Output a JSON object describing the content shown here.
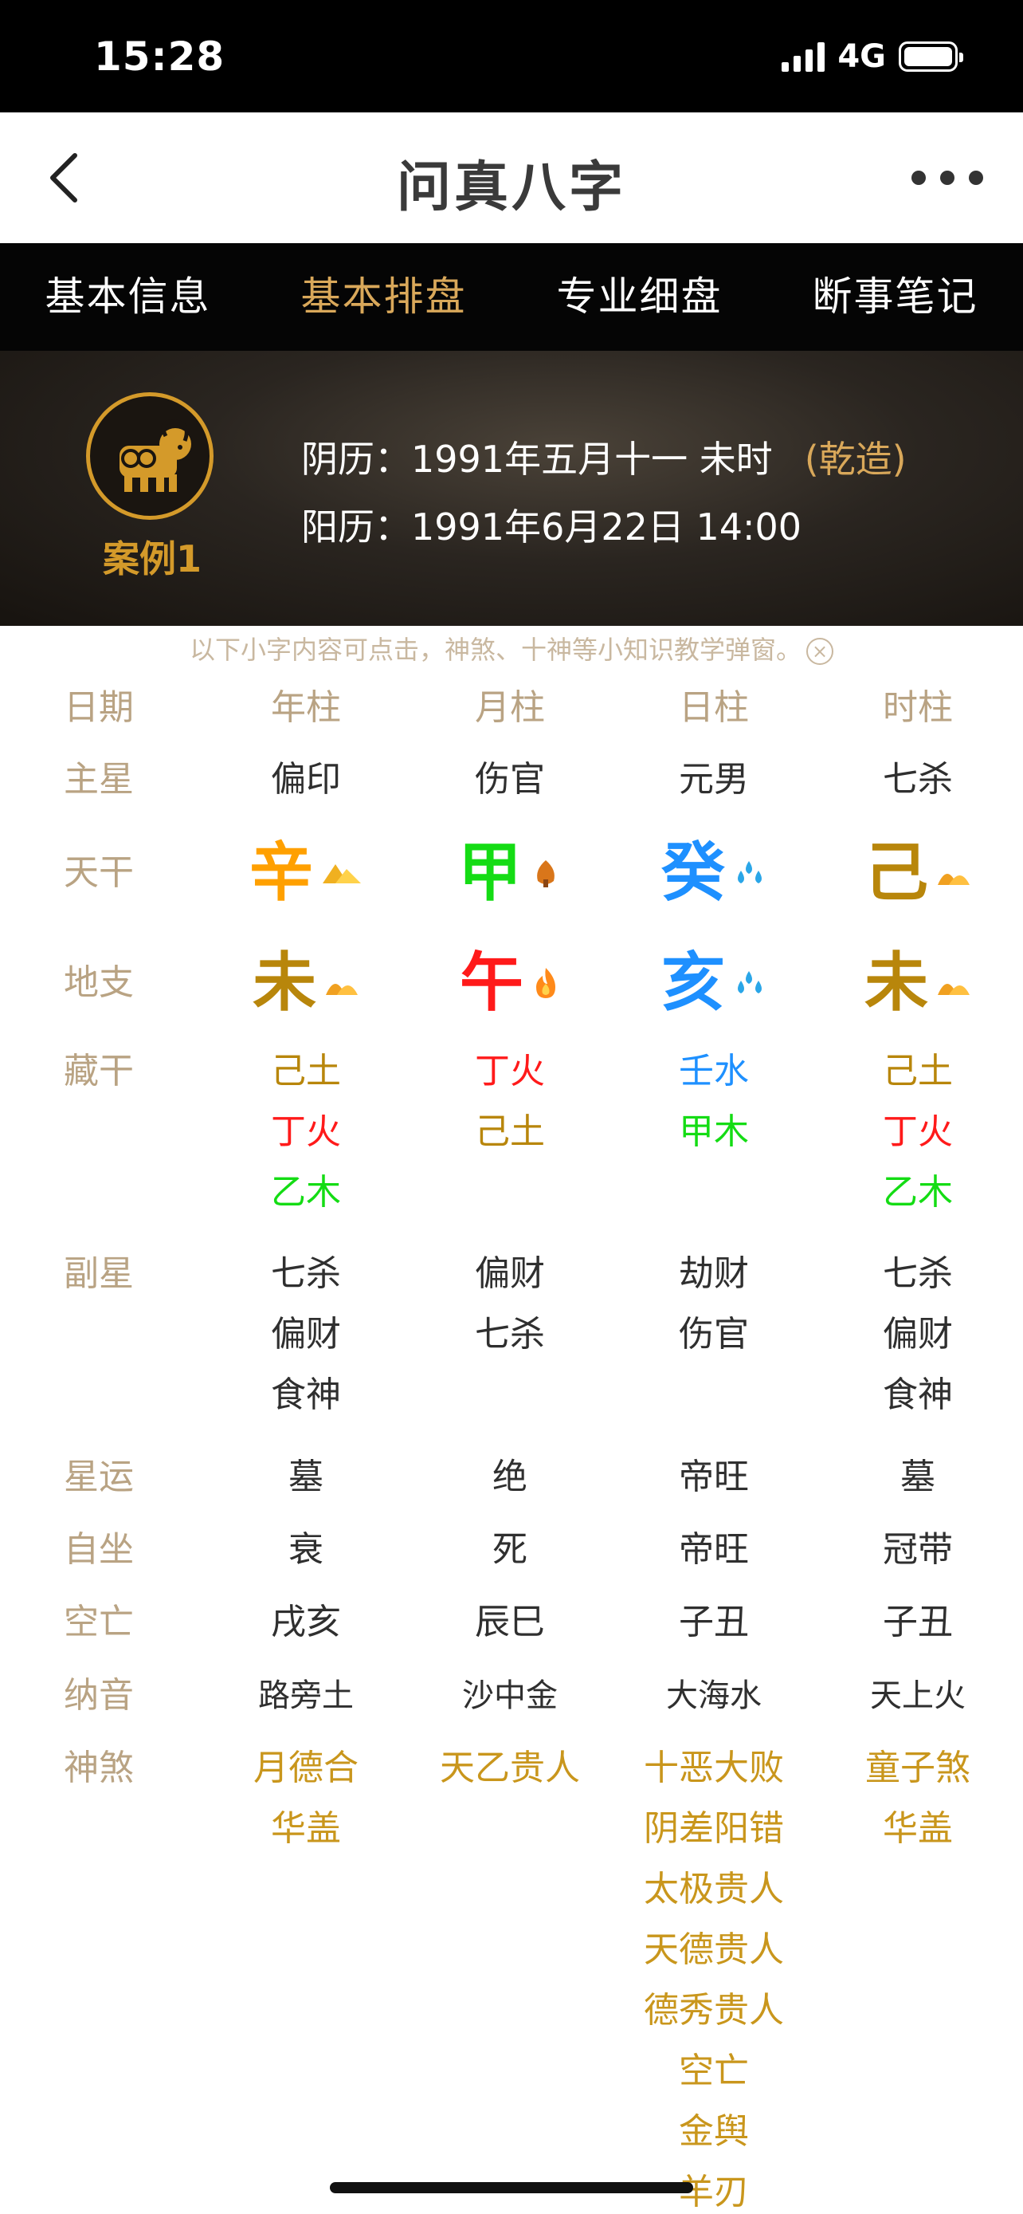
{
  "status_bar": {
    "time": "15:28",
    "network": "4G"
  },
  "nav": {
    "title": "问真八字"
  },
  "tabs": [
    {
      "label": "基本信息",
      "active": false
    },
    {
      "label": "基本排盘",
      "active": true
    },
    {
      "label": "专业细盘",
      "active": false
    },
    {
      "label": "断事笔记",
      "active": false
    }
  ],
  "profile": {
    "case_label": "案例1",
    "lunar": "阴历：1991年五月十一 未时",
    "gender_tag": "(乾造)",
    "solar": "阳历：1991年6月22日 14:00"
  },
  "hint": {
    "text": "以下小字内容可点击，神煞、十神等小知识教学弹窗。",
    "close_glyph": "×"
  },
  "colors": {
    "accent": "#d9a85a",
    "label": "#b9a383",
    "earth": "#b8860b",
    "fire": "#ff1a1a",
    "wood": "#14dc14",
    "water": "#1e90ff",
    "metal": "#ffa000"
  },
  "table": {
    "labels": {
      "date": "日期",
      "main_star": "主星",
      "stem": "天干",
      "branch": "地支",
      "hidden": "藏干",
      "sub_star": "副星",
      "star_luck": "星运",
      "self_seat": "自坐",
      "void": "空亡",
      "nayin": "纳音",
      "shensha": "神煞"
    },
    "columns": [
      {
        "header": "年柱",
        "main_star": "偏印",
        "stem": {
          "char": "辛",
          "element": "metal"
        },
        "branch": {
          "char": "未",
          "element": "earth"
        },
        "hidden": [
          {
            "text": "己土",
            "element": "earth"
          },
          {
            "text": "丁火",
            "element": "fire"
          },
          {
            "text": "乙木",
            "element": "wood"
          }
        ],
        "sub_stars": [
          "七杀",
          "偏财",
          "食神"
        ],
        "star_luck": "墓",
        "self_seat": "衰",
        "void": "戌亥",
        "nayin": "路旁土",
        "shensha": [
          "月德合",
          "华盖"
        ]
      },
      {
        "header": "月柱",
        "main_star": "伤官",
        "stem": {
          "char": "甲",
          "element": "wood"
        },
        "branch": {
          "char": "午",
          "element": "fire"
        },
        "hidden": [
          {
            "text": "丁火",
            "element": "fire"
          },
          {
            "text": "己土",
            "element": "earth"
          }
        ],
        "sub_stars": [
          "偏财",
          "七杀"
        ],
        "star_luck": "绝",
        "self_seat": "死",
        "void": "辰巳",
        "nayin": "沙中金",
        "shensha": [
          "天乙贵人"
        ]
      },
      {
        "header": "日柱",
        "main_star": "元男",
        "stem": {
          "char": "癸",
          "element": "water"
        },
        "branch": {
          "char": "亥",
          "element": "water"
        },
        "hidden": [
          {
            "text": "壬水",
            "element": "water"
          },
          {
            "text": "甲木",
            "element": "wood"
          }
        ],
        "sub_stars": [
          "劫财",
          "伤官"
        ],
        "star_luck": "帝旺",
        "self_seat": "帝旺",
        "void": "子丑",
        "nayin": "大海水",
        "shensha": [
          "十恶大败",
          "阴差阳错",
          "太极贵人",
          "天德贵人",
          "德秀贵人",
          "空亡",
          "金舆",
          "羊刃"
        ]
      },
      {
        "header": "时柱",
        "main_star": "七杀",
        "stem": {
          "char": "己",
          "element": "earth"
        },
        "branch": {
          "char": "未",
          "element": "earth"
        },
        "hidden": [
          {
            "text": "己土",
            "element": "earth"
          },
          {
            "text": "丁火",
            "element": "fire"
          },
          {
            "text": "乙木",
            "element": "wood"
          }
        ],
        "sub_stars": [
          "七杀",
          "偏财",
          "食神"
        ],
        "star_luck": "墓",
        "self_seat": "冠带",
        "void": "子丑",
        "nayin": "天上火",
        "shensha": [
          "童子煞",
          "华盖"
        ]
      }
    ]
  }
}
